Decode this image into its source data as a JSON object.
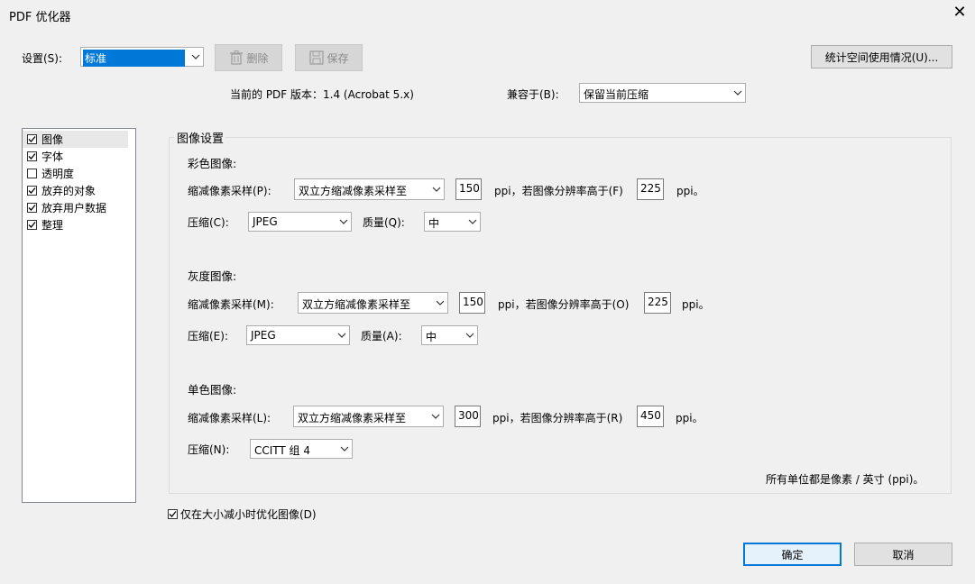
{
  "window": {
    "title": "PDF 优化器",
    "close_glyph": "✕"
  },
  "settings": {
    "label": "设置(S):",
    "value": "标准",
    "delete_label": "删除",
    "save_label": "保存",
    "space_audit_label": "统计空间使用情况(U)..."
  },
  "version": {
    "text": "当前的 PDF 版本：1.4 (Acrobat 5.x)",
    "compat_label": "兼容于(B):",
    "compat_value": "保留当前压缩"
  },
  "sidebar": {
    "items": [
      {
        "label": "图像",
        "checked": true
      },
      {
        "label": "字体",
        "checked": true
      },
      {
        "label": "透明度",
        "checked": false
      },
      {
        "label": "放弃的对象",
        "checked": true
      },
      {
        "label": "放弃用户数据",
        "checked": true
      },
      {
        "label": "整理",
        "checked": true
      }
    ]
  },
  "image_settings": {
    "legend": "图像设置",
    "color": {
      "title": "彩色图像:",
      "downsample_label": "缩减像素采样(P):",
      "downsample_value": "双立方缩减像素采样至",
      "ppi": "150",
      "ppi_suffix": "ppi，若图像分辨率高于(F)",
      "above": "225",
      "above_suffix": "ppi。",
      "compression_label": "压缩(C):",
      "compression_value": "JPEG",
      "quality_label": "质量(Q):",
      "quality_value": "中"
    },
    "gray": {
      "title": "灰度图像:",
      "downsample_label": "缩减像素采样(M):",
      "downsample_value": "双立方缩减像素采样至",
      "ppi": "150",
      "ppi_suffix": "ppi，若图像分辨率高于(O)",
      "above": "225",
      "above_suffix": "ppi。",
      "compression_label": "压缩(E):",
      "compression_value": "JPEG",
      "quality_label": "质量(A):",
      "quality_value": "中"
    },
    "mono": {
      "title": "单色图像:",
      "downsample_label": "缩减像素采样(L):",
      "downsample_value": "双立方缩减像素采样至",
      "ppi": "300",
      "ppi_suffix": "ppi，若图像分辨率高于(R)",
      "above": "450",
      "above_suffix": "ppi。",
      "compression_label": "压缩(N):",
      "compression_value": "CCITT 组 4"
    },
    "units_note": "所有单位都是像素 / 英寸 (ppi)。"
  },
  "optimize_only_if_smaller": {
    "label": "仅在大小减小时优化图像(D)",
    "checked": true
  },
  "buttons": {
    "ok": "确定",
    "cancel": "取消"
  },
  "colors": {
    "accent": "#0078d7"
  }
}
